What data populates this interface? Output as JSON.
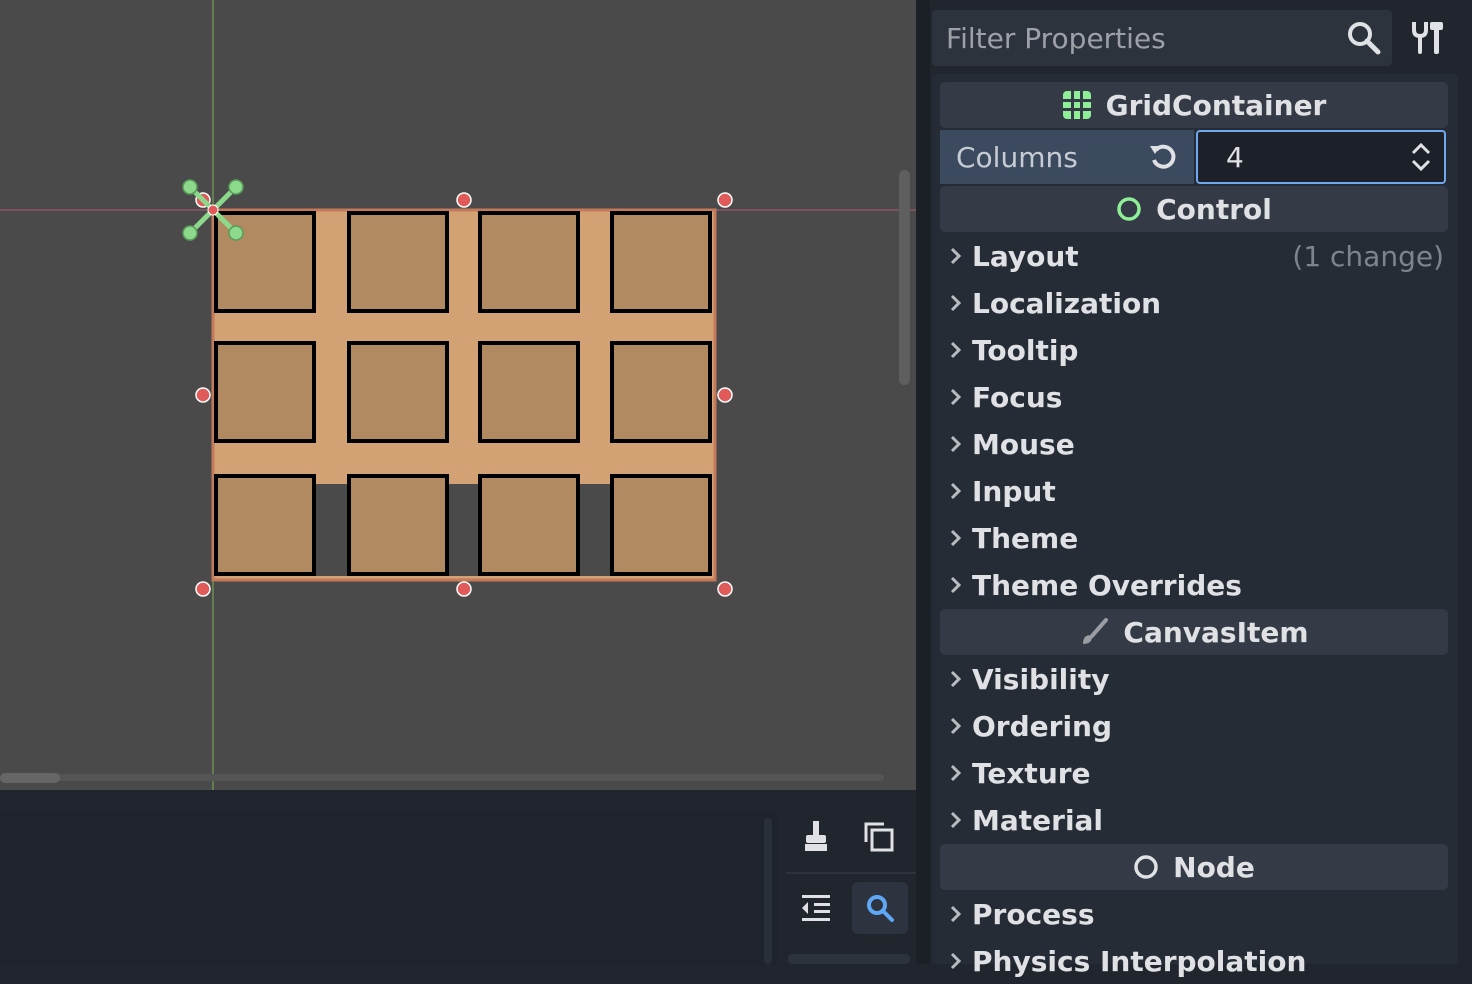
{
  "inspector": {
    "filter_placeholder": "Filter Properties",
    "sections": {
      "grid_container": "GridContainer",
      "control": "Control",
      "canvas_item": "CanvasItem",
      "node": "Node"
    },
    "columns": {
      "label": "Columns",
      "value": "4"
    },
    "control_groups": [
      {
        "label": "Layout",
        "note": "(1 change)"
      },
      {
        "label": "Localization"
      },
      {
        "label": "Tooltip"
      },
      {
        "label": "Focus"
      },
      {
        "label": "Mouse"
      },
      {
        "label": "Input"
      },
      {
        "label": "Theme"
      },
      {
        "label": "Theme Overrides"
      }
    ],
    "canvas_item_groups": [
      {
        "label": "Visibility"
      },
      {
        "label": "Ordering"
      },
      {
        "label": "Texture"
      },
      {
        "label": "Material"
      }
    ],
    "node_groups": [
      {
        "label": "Process"
      },
      {
        "label": "Physics Interpolation"
      }
    ]
  },
  "viewport": {
    "grid": {
      "columns": 4,
      "rows": 3
    },
    "colors": {
      "background": "#4a4a4a",
      "tile_fill": "#b28a62",
      "tile_bg": "#d2a174",
      "tile_outline": "#000000",
      "selection": "#d97a5a",
      "handle": "#e05a5a",
      "pivot": "#8cd98c"
    }
  },
  "icons": {
    "search": "search-icon",
    "tools": "tools-icon",
    "grid": "grid-icon",
    "control": "control-circle-icon",
    "canvas_item": "brush-icon",
    "node": "node-circle-icon",
    "revert": "revert-icon",
    "clear": "broom-icon",
    "copy": "copy-icon",
    "collapse": "collapse-icon",
    "find": "find-icon"
  }
}
